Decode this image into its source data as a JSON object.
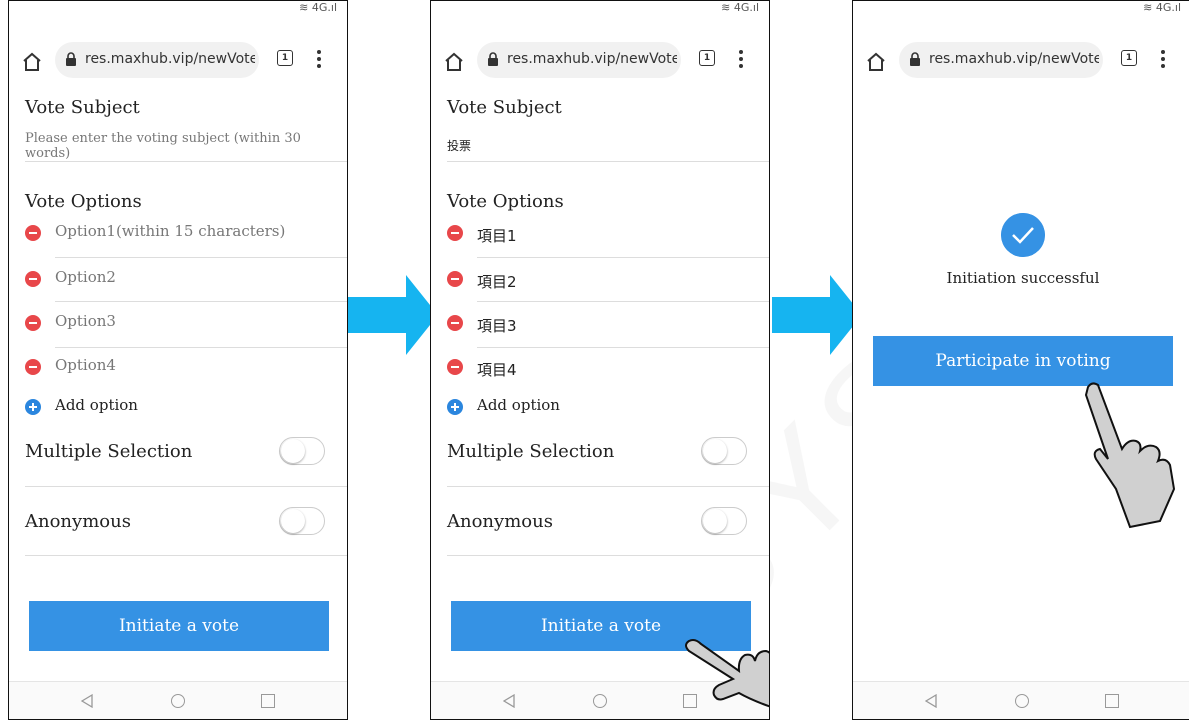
{
  "status": {
    "signal": "4G"
  },
  "browser": {
    "url": "res.maxhub.vip/newVote",
    "tab_count": "1"
  },
  "screen1": {
    "subject_heading": "Vote Subject",
    "subject_placeholder": "Please enter the voting subject (within 30 words)",
    "options_heading": "Vote Options",
    "options": [
      "Option1(within 15 characters)",
      "Option2",
      "Option3",
      "Option4"
    ],
    "add_option": "Add option",
    "multiple_label": "Multiple Selection",
    "anonymous_label": "Anonymous",
    "submit": "Initiate a vote"
  },
  "screen2": {
    "subject_heading": "Vote Subject",
    "subject_value": "投票",
    "options_heading": "Vote Options",
    "options": [
      "項目1",
      "項目2",
      "項目3",
      "項目4"
    ],
    "add_option": "Add option",
    "multiple_label": "Multiple Selection",
    "anonymous_label": "Anonymous",
    "submit": "Initiate a vote"
  },
  "screen3": {
    "success_message": "Initiation successful",
    "participate": "Participate in voting"
  },
  "watermark": "SYSTEM",
  "colors": {
    "accent": "#3592e4",
    "delete": "#e8474a",
    "arrow": "#16b4f0"
  }
}
